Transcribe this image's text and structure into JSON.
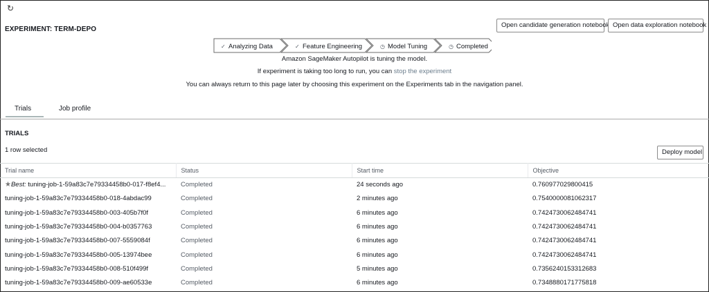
{
  "header": {
    "refresh_icon": "refresh-icon",
    "experiment_title": "EXPERIMENT: TERM-DEPO",
    "open_candidate_label": "Open candidate generation notebook",
    "open_exploration_label": "Open data exploration notebook"
  },
  "steps": [
    {
      "label": "Analyzing Data",
      "icon": "check-icon",
      "glyph": "✓"
    },
    {
      "label": "Feature Engineering",
      "icon": "check-icon",
      "glyph": "✓"
    },
    {
      "label": "Model Tuning",
      "icon": "clock-icon",
      "glyph": "◷"
    },
    {
      "label": "Completed",
      "icon": "clock-icon",
      "glyph": "◷"
    }
  ],
  "messages": {
    "tuning": "Amazon SageMaker Autopilot is tuning the model.",
    "long_run_prefix": "If experiment is taking too long to run, you can",
    "stop_link": "stop the experiment",
    "return_note": "You can always return to this page later by choosing this experiment on the Experiments tab in the navigation panel."
  },
  "tabs": [
    {
      "label": "Trials",
      "active": true
    },
    {
      "label": "Job profile",
      "active": false
    }
  ],
  "trials": {
    "heading": "TRIALS",
    "selection": "1 row selected",
    "deploy_label": "Deploy model",
    "columns": [
      "Trial name",
      "Status",
      "Start time",
      "Objective"
    ],
    "best_prefix": "Best:",
    "rows": [
      {
        "best": true,
        "name": "tuning-job-1-59a83c7e79334458b0-017-f8ef4...",
        "status": "Completed",
        "start": "24 seconds ago",
        "objective": "0.760977029800415"
      },
      {
        "best": false,
        "name": "tuning-job-1-59a83c7e79334458b0-018-4abdac99",
        "status": "Completed",
        "start": "2 minutes ago",
        "objective": "0.7540000081062317"
      },
      {
        "best": false,
        "name": "tuning-job-1-59a83c7e79334458b0-003-405b7f0f",
        "status": "Completed",
        "start": "6 minutes ago",
        "objective": "0.7424730062484741"
      },
      {
        "best": false,
        "name": "tuning-job-1-59a83c7e79334458b0-004-b0357763",
        "status": "Completed",
        "start": "6 minutes ago",
        "objective": "0.7424730062484741"
      },
      {
        "best": false,
        "name": "tuning-job-1-59a83c7e79334458b0-007-5559084f",
        "status": "Completed",
        "start": "6 minutes ago",
        "objective": "0.7424730062484741"
      },
      {
        "best": false,
        "name": "tuning-job-1-59a83c7e79334458b0-005-13974bee",
        "status": "Completed",
        "start": "6 minutes ago",
        "objective": "0.7424730062484741"
      },
      {
        "best": false,
        "name": "tuning-job-1-59a83c7e79334458b0-008-510f499f",
        "status": "Completed",
        "start": "5 minutes ago",
        "objective": "0.7356240153312683"
      },
      {
        "best": false,
        "name": "tuning-job-1-59a83c7e79334458b0-009-ae60533e",
        "status": "Completed",
        "start": "6 minutes ago",
        "objective": "0.7348880171775818"
      }
    ]
  }
}
